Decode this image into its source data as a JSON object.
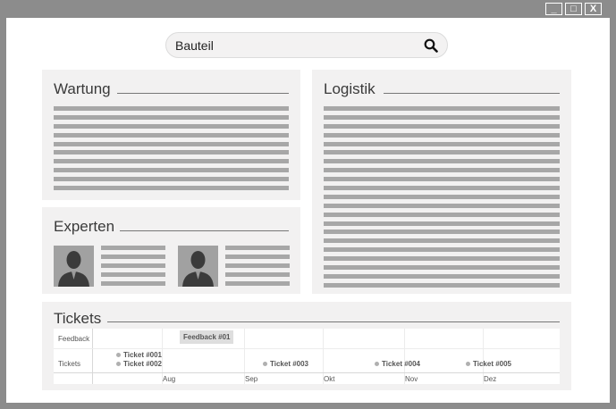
{
  "window": {
    "controls": {
      "minimize": "_",
      "maximize": "□",
      "close": "X"
    }
  },
  "search": {
    "value": "Bauteil"
  },
  "panels": {
    "wartung": {
      "title": "Wartung"
    },
    "logistik": {
      "title": "Logistik"
    },
    "experten": {
      "title": "Experten"
    },
    "tickets": {
      "title": "Tickets"
    }
  },
  "timeline": {
    "rows": [
      "Feedback",
      "Tickets"
    ],
    "feedback_chip": "Feedback #01",
    "tickets": [
      "Ticket #001",
      "Ticket #002",
      "Ticket #003",
      "Ticket #004",
      "Ticket #005"
    ],
    "months": [
      "Aug",
      "Sep",
      "Okt",
      "Nov",
      "Dez"
    ]
  }
}
